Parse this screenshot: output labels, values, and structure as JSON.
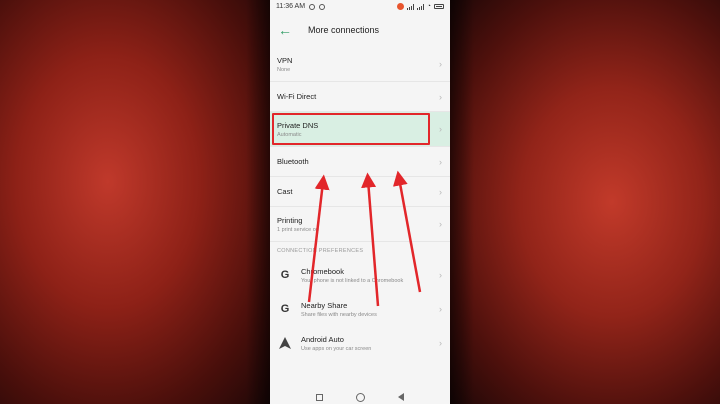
{
  "status": {
    "time": "11:36 AM"
  },
  "header": {
    "back_glyph": "←",
    "title": "More connections"
  },
  "rows": {
    "vpn": {
      "label": "VPN",
      "sub": "None"
    },
    "wifi_direct": {
      "label": "Wi-Fi Direct"
    },
    "private_dns": {
      "label": "Private DNS",
      "sub": "Automatic"
    },
    "bluetooth": {
      "label": "Bluetooth"
    },
    "cast": {
      "label": "Cast"
    },
    "printing": {
      "label": "Printing",
      "sub": "1 print service on"
    }
  },
  "section": {
    "title": "CONNECTION PREFERENCES"
  },
  "apps": {
    "chromebook": {
      "icon": "G",
      "label": "Chromebook",
      "sub": "Your phone is not linked to a Chromebook"
    },
    "nearby_share": {
      "icon": "G",
      "label": "Nearby Share",
      "sub": "Share files with nearby devices"
    },
    "android_auto": {
      "icon": "android-auto-icon",
      "label": "Android Auto",
      "sub": "Use apps on your car screen"
    }
  },
  "chevron": "›",
  "colors": {
    "accent": "#2e9c63",
    "highlight": "#d9efe3",
    "annotation": "#e2262a"
  },
  "icons": [
    "back-arrow-icon",
    "google-g-icon",
    "android-auto-icon",
    "chevron-right-icon",
    "recents-icon",
    "home-icon",
    "back-icon"
  ]
}
